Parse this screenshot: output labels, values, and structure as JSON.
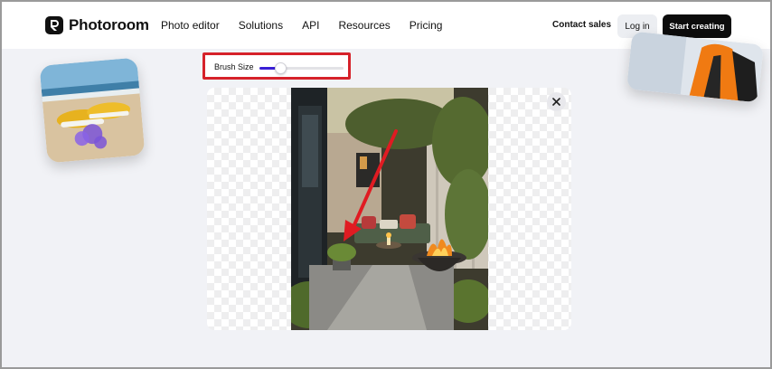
{
  "header": {
    "brand": "Photoroom",
    "nav": [
      "Photo editor",
      "Solutions",
      "API",
      "Resources",
      "Pricing"
    ],
    "contact_sales": "Contact sales",
    "log_in": "Log in",
    "start_creating": "Start creating"
  },
  "toolbar": {
    "brush_label": "Brush Size",
    "brush_size_fraction": 0.25,
    "slider_color": "#3a1fd6",
    "highlight_color": "#d6222a"
  },
  "editor": {
    "close_icon": "close-icon",
    "annotation_color": "#e01b22"
  },
  "colors": {
    "accent": "#0c0c0c",
    "background": "#f1f2f6"
  }
}
